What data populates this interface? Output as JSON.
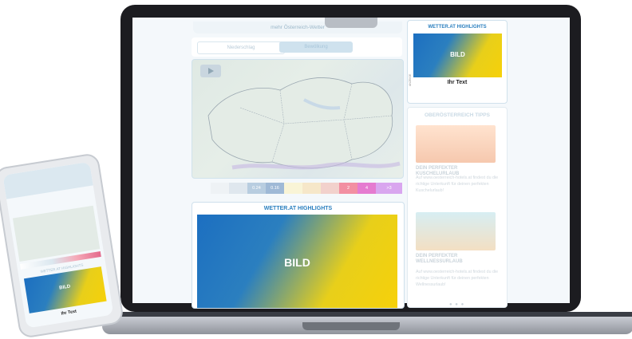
{
  "laptop": {
    "top_link": "mehr Österreich-Wetter",
    "tabs": [
      {
        "label": "Niederschlag",
        "active": false
      },
      {
        "label": "Bewölkung",
        "active": true
      }
    ],
    "legend": {
      "label": "",
      "cells": [
        {
          "label": "",
          "color": "#eef2f5"
        },
        {
          "label": "",
          "color": "#dfe7ee"
        },
        {
          "label": "0.24",
          "color": "#b8cde0"
        },
        {
          "label": "0.16",
          "color": "#9fb9d6"
        },
        {
          "label": "",
          "color": "#f9f4d6"
        },
        {
          "label": "",
          "color": "#f6e7c9"
        },
        {
          "label": "",
          "color": "#f2d1cc"
        },
        {
          "label": "2",
          "color": "#f28fa2"
        },
        {
          "label": "4",
          "color": "#e57bd0"
        },
        {
          "label": ">3",
          "color": "#d9a6ef"
        }
      ]
    },
    "highlights": {
      "title": "WETTER.AT HIGHLIGHTS",
      "image_text": "BILD"
    },
    "sidebar": {
      "highlights": {
        "title": "WETTER.AT HIGHLIGHTS",
        "image_text": "BILD",
        "caption": "Ihr Text",
        "ad_label": "ANZEIGE"
      },
      "tipps": {
        "title": "OBERÖSTERREICH TIPPS",
        "items": [
          {
            "heading": "DEIN PERFEKTER KUSCHELURLAUB",
            "text": "Auf www.oesterreich-hotels.at findest du die richtige Unterkunft für deinen perfekten Kuschelurlaub!"
          },
          {
            "heading": "DEIN PERFEKTER WELLNESSURLAUB",
            "text": "Auf www.oesterreich-hotels.at findest du die richtige Unterkunft für deinen perfekten Wellnessurlaub!"
          }
        ],
        "dots": "● ● ●"
      }
    }
  },
  "phone": {
    "highlights_title": "WETTER.AT HIGHLIGHTS",
    "image_text": "BILD",
    "caption": "Ihr Text"
  }
}
